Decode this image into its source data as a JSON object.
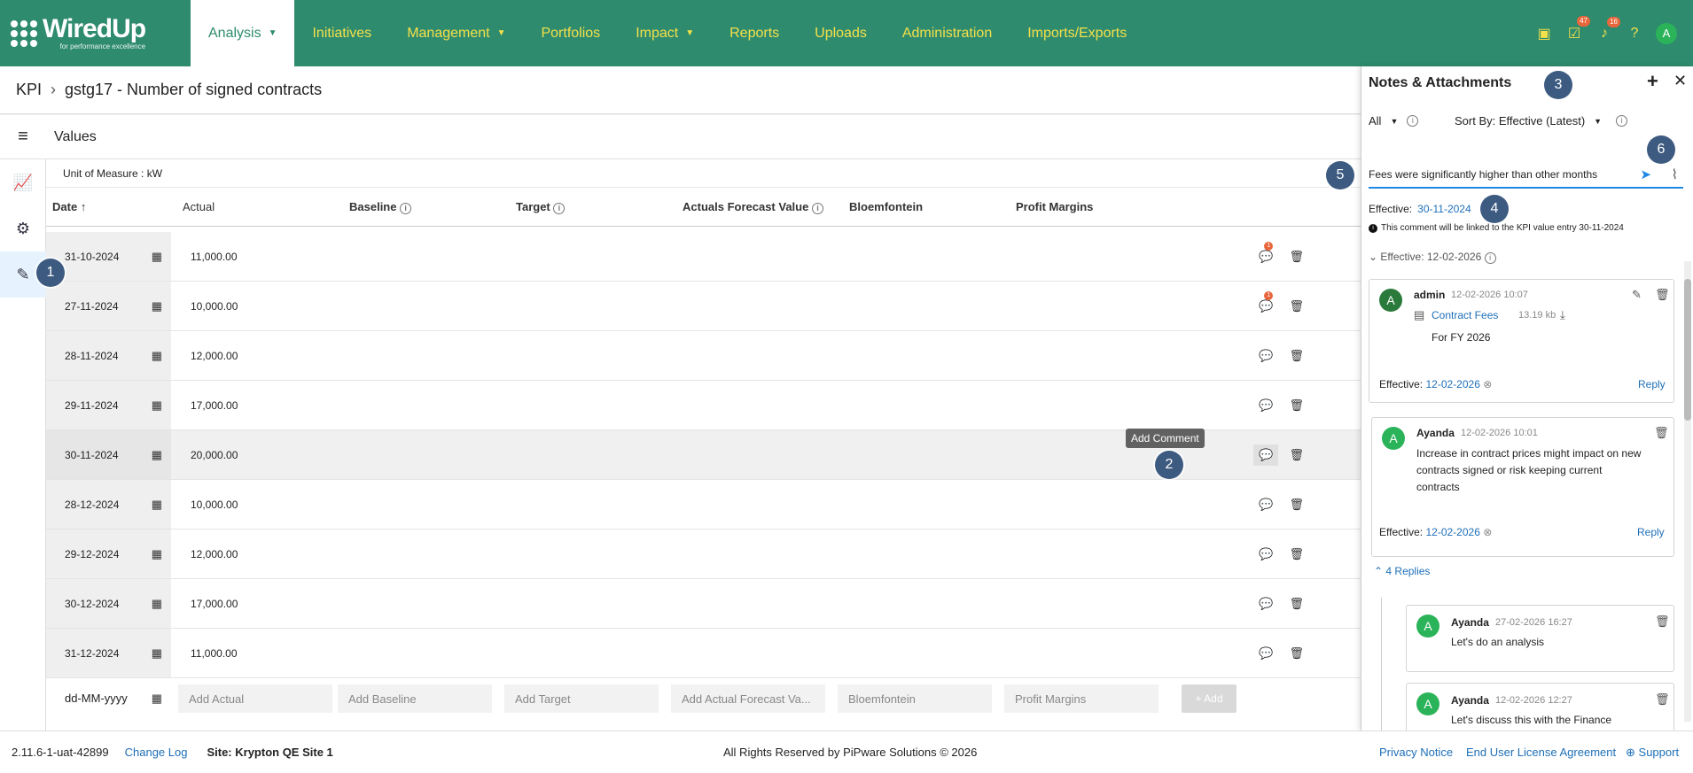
{
  "app": {
    "logo": "WiredUp",
    "logo_tagline": "for performance excellence"
  },
  "nav": [
    {
      "label": "Analysis",
      "caret": true,
      "active": true
    },
    {
      "label": "Initiatives"
    },
    {
      "label": "Management",
      "caret": true
    },
    {
      "label": "Portfolios"
    },
    {
      "label": "Impact",
      "caret": true
    },
    {
      "label": "Reports"
    },
    {
      "label": "Uploads"
    },
    {
      "label": "Administration"
    },
    {
      "label": "Imports/Exports"
    }
  ],
  "topbar": {
    "tasks_badge": "47",
    "notifications_badge": "16",
    "user_initial": "A"
  },
  "breadcrumb": {
    "root": "KPI",
    "current": "gstg17 - Number of signed contracts"
  },
  "section": {
    "title": "Values",
    "unit_of_measure": "Unit of Measure : kW"
  },
  "table": {
    "headers": {
      "date": "Date",
      "actual": "Actual",
      "baseline": "Baseline",
      "target": "Target",
      "forecast": "Actuals Forecast Value",
      "bloemfontein": "Bloemfontein",
      "profit": "Profit Margins"
    },
    "rows": [
      {
        "date": "31-10-2024",
        "actual": "11,000.00",
        "comments": "1"
      },
      {
        "date": "27-11-2024",
        "actual": "10,000.00",
        "comments": "1"
      },
      {
        "date": "28-11-2024",
        "actual": "12,000.00",
        "comments": ""
      },
      {
        "date": "29-11-2024",
        "actual": "17,000.00",
        "comments": ""
      },
      {
        "date": "30-11-2024",
        "actual": "20,000.00",
        "comments": ""
      },
      {
        "date": "28-12-2024",
        "actual": "10,000.00",
        "comments": ""
      },
      {
        "date": "29-12-2024",
        "actual": "12,000.00",
        "comments": ""
      },
      {
        "date": "30-12-2024",
        "actual": "17,000.00",
        "comments": ""
      },
      {
        "date": "31-12-2024",
        "actual": "11,000.00",
        "comments": ""
      }
    ],
    "new_row": {
      "date": "dd-MM-yyyy",
      "actual": "Add Actual",
      "baseline": "Add Baseline",
      "target": "Add Target",
      "forecast": "Add Actual Forecast Va...",
      "bloemfontein": "Bloemfontein",
      "profit": "Profit Margins",
      "add": "+ Add"
    },
    "tooltip": "Add Comment"
  },
  "panel": {
    "title": "Notes & Attachments",
    "filter": "All",
    "sort": "Sort By: Effective (Latest)",
    "input_value": "Fees were significantly higher than other months",
    "effective_label": "Effective:",
    "effective_date": "30-11-2024",
    "note": "This comment will be linked to the KPI value entry 30-11-2024",
    "group": "Effective: 12-02-2026",
    "comments": [
      {
        "initial": "A",
        "name": "admin",
        "time": "12-02-2026 10:07",
        "attachment": "Contract Fees",
        "size": "13.19 kb",
        "body": "For FY 2026",
        "effective_label": "Effective:",
        "effective": "12-02-2026",
        "reply": "Reply"
      },
      {
        "initial": "A",
        "name": "Ayanda",
        "time": "12-02-2026 10:01",
        "body_lines": [
          "Increase in contract prices might impact on new",
          "contracts signed or risk keeping current",
          "contracts"
        ],
        "effective_label": "Effective:",
        "effective": "12-02-2026",
        "reply": "Reply"
      }
    ],
    "replies_label": "4 Replies",
    "replies": [
      {
        "initial": "A",
        "name": "Ayanda",
        "time": "27-02-2026 16:27",
        "body": "Let's do an analysis"
      },
      {
        "initial": "A",
        "name": "Ayanda",
        "time": "12-02-2026 12:27",
        "body": "Let's discuss this with the Finance"
      }
    ]
  },
  "footer": {
    "version": "2.11.6-1-uat-42899",
    "changelog": "Change Log",
    "site": "Site: Krypton QE Site 1",
    "copyright": "All Rights Reserved by PiPware Solutions © 2026",
    "privacy": "Privacy Notice",
    "eula": "End User License Agreement",
    "support": "Support"
  },
  "markers": [
    "1",
    "2",
    "3",
    "4",
    "5",
    "6"
  ],
  "colors": {
    "brand": "#2e8b6e",
    "nav_text": "#f3e04a",
    "link": "#1e6fb8",
    "badge": "#e8663c"
  }
}
